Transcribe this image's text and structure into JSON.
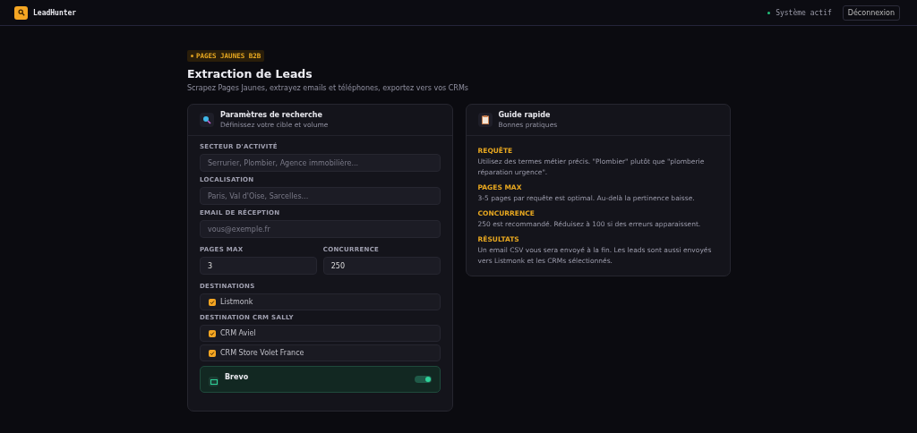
{
  "header": {
    "app_name": "LeadHunter",
    "status": {
      "label": "Système actif",
      "on": true
    },
    "logout_button": "Déconnexion"
  },
  "badge": "PAGES JAUNES B2B",
  "title": "Extraction de Leads",
  "subtitle": "Scrapez Pages Jaunes, extrayez emails et téléphones, exportez vers vos CRMs",
  "search_card": {
    "title": "Paramètres de recherche",
    "subtitle": "Définissez votre cible et volume",
    "fields": [
      {
        "label": "SECTEUR D'ACTIVITÉ",
        "placeholder": "Serrurier, Plombier, Agence immobilière..."
      },
      {
        "label": "LOCALISATION",
        "placeholder": "Paris, Val d'Oise, Sarcelles..."
      },
      {
        "label": "EMAIL DE RÉCEPTION",
        "placeholder": "vous@exemple.fr"
      }
    ],
    "numeric_fields": [
      {
        "label": "PAGES MAX",
        "value": "3"
      },
      {
        "label": "CONCURRENCE",
        "value": "250"
      }
    ],
    "groups": [
      {
        "label": "DESTINATIONS",
        "options": [
          {
            "label": "Listmonk",
            "checked": true
          }
        ]
      },
      {
        "label": "DESTINATION CRM SALLY",
        "options": [
          {
            "label": "CRM Aviel",
            "checked": true
          },
          {
            "label": "CRM Store Volet France",
            "checked": true
          }
        ]
      }
    ],
    "brevo": {
      "title": "Brevo",
      "on": true
    }
  },
  "guide_card": {
    "title": "Guide rapide",
    "subtitle": "Bonnes pratiques",
    "sections": [
      {
        "heading": "REQUÊTE",
        "text": "Utilisez des termes métier précis. \"Plombier\" plutôt que \"plomberie réparation urgence\"."
      },
      {
        "heading": "PAGES MAX",
        "text": "3-5 pages par requête est optimal. Au-delà la pertinence baisse."
      },
      {
        "heading": "CONCURRENCE",
        "text": "250 est recommandé. Réduisez à 100 si des erreurs apparaissent."
      },
      {
        "heading": "RÉSULTATS",
        "text": "Un email CSV vous sera envoyé à la fin. Les leads sont aussi envoyés vers Listmonk et les CRMs sélectionnés."
      }
    ]
  }
}
